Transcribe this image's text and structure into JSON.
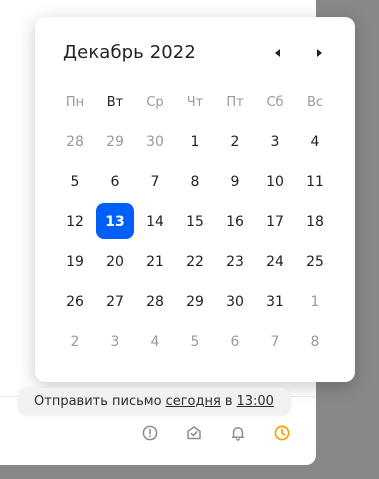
{
  "calendar": {
    "title": "Декабрь 2022",
    "weekdays": [
      "Пн",
      "Вт",
      "Ср",
      "Чт",
      "Пт",
      "Сб",
      "Вс"
    ],
    "current_weekday_index": 1,
    "weeks": [
      [
        "28",
        "29",
        "30",
        "1",
        "2",
        "3",
        "4"
      ],
      [
        "5",
        "6",
        "7",
        "8",
        "9",
        "10",
        "11"
      ],
      [
        "12",
        "13",
        "14",
        "15",
        "16",
        "17",
        "18"
      ],
      [
        "19",
        "20",
        "21",
        "22",
        "23",
        "24",
        "25"
      ],
      [
        "26",
        "27",
        "28",
        "29",
        "30",
        "31",
        "1"
      ],
      [
        "2",
        "3",
        "4",
        "5",
        "6",
        "7",
        "8"
      ]
    ],
    "selected_day": "13",
    "accent_color": "#005ff9"
  },
  "tooltip": {
    "prefix": "Отправить письмо",
    "date_link": "сегодня",
    "middle": "в",
    "time_link": "13:00"
  },
  "toolbar": {
    "icons": [
      "exclamation-circle-icon",
      "check-envelope-icon",
      "bell-icon",
      "clock-icon"
    ],
    "active_color": "#ff9e00"
  }
}
